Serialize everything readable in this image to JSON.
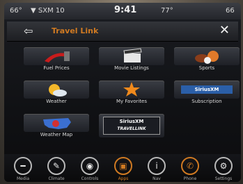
{
  "status": {
    "left_temp": "66°",
    "signal": "▼ SXM 10",
    "time": "9:41",
    "center_right": "77°",
    "right_temp": "66"
  },
  "header": {
    "title": "Travel Link",
    "back_icon": "back-arrow-icon",
    "close_icon": "close-icon"
  },
  "tiles": [
    {
      "label": "Fuel Prices",
      "icon": "fuel-pump-icon"
    },
    {
      "label": "Movie Listings",
      "icon": "clapperboard-icon"
    },
    {
      "label": "Sports",
      "icon": "sports-balls-icon"
    },
    {
      "label": "Weather",
      "icon": "weather-sun-icon"
    },
    {
      "label": "My Favorites",
      "icon": "star-icon"
    },
    {
      "label": "Subscription",
      "icon": "siriusxm-badge-icon",
      "badge": "SiriusXM"
    },
    {
      "label": "Weather Map",
      "icon": "usa-map-icon"
    },
    {
      "label": "",
      "icon": "siriusxm-travel-link-icon",
      "badge_top": "SiriusXM",
      "badge_bottom": "TRAVELLINK"
    }
  ],
  "dock": [
    {
      "label": "Media",
      "icon": "media-icon"
    },
    {
      "label": "Climate",
      "icon": "climate-icon"
    },
    {
      "label": "Controls",
      "icon": "controls-icon"
    },
    {
      "label": "Apps",
      "icon": "apps-icon"
    },
    {
      "label": "Nav",
      "icon": "nav-icon"
    },
    {
      "label": "Phone",
      "icon": "phone-icon"
    },
    {
      "label": "Settings",
      "icon": "settings-icon"
    }
  ],
  "colors": {
    "accent": "#d07a22",
    "background": "#101114"
  }
}
